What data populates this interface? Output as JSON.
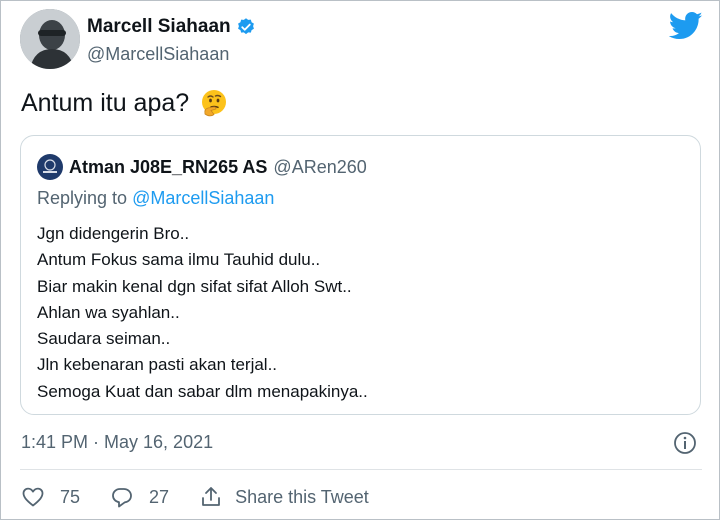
{
  "author": {
    "name": "Marcell Siahaan",
    "handle": "@MarcellSiahaan"
  },
  "tweet": {
    "text": "Antum itu apa?",
    "emoji": "thinking-face"
  },
  "quote": {
    "name": "Atman J08E_RN265 AS",
    "handle": "@ARen260",
    "replying_prefix": "Replying to",
    "replying_to": "@MarcellSiahaan",
    "lines": [
      "Jgn didengerin Bro..",
      "Antum Fokus sama ilmu Tauhid dulu..",
      "Biar makin kenal dgn sifat sifat  Alloh Swt..",
      "Ahlan wa syahlan..",
      "Saudara seiman..",
      "Jln kebenaran pasti akan terjal..",
      "Semoga Kuat dan sabar dlm menapakinya.."
    ]
  },
  "timestamp": "1:41 PM · May 16, 2021",
  "actions": {
    "likes": "75",
    "replies": "27",
    "share_label": "Share this Tweet"
  },
  "colors": {
    "accent": "#1d9bf0",
    "secondary_text": "#536471",
    "border": "#cfd9de"
  }
}
